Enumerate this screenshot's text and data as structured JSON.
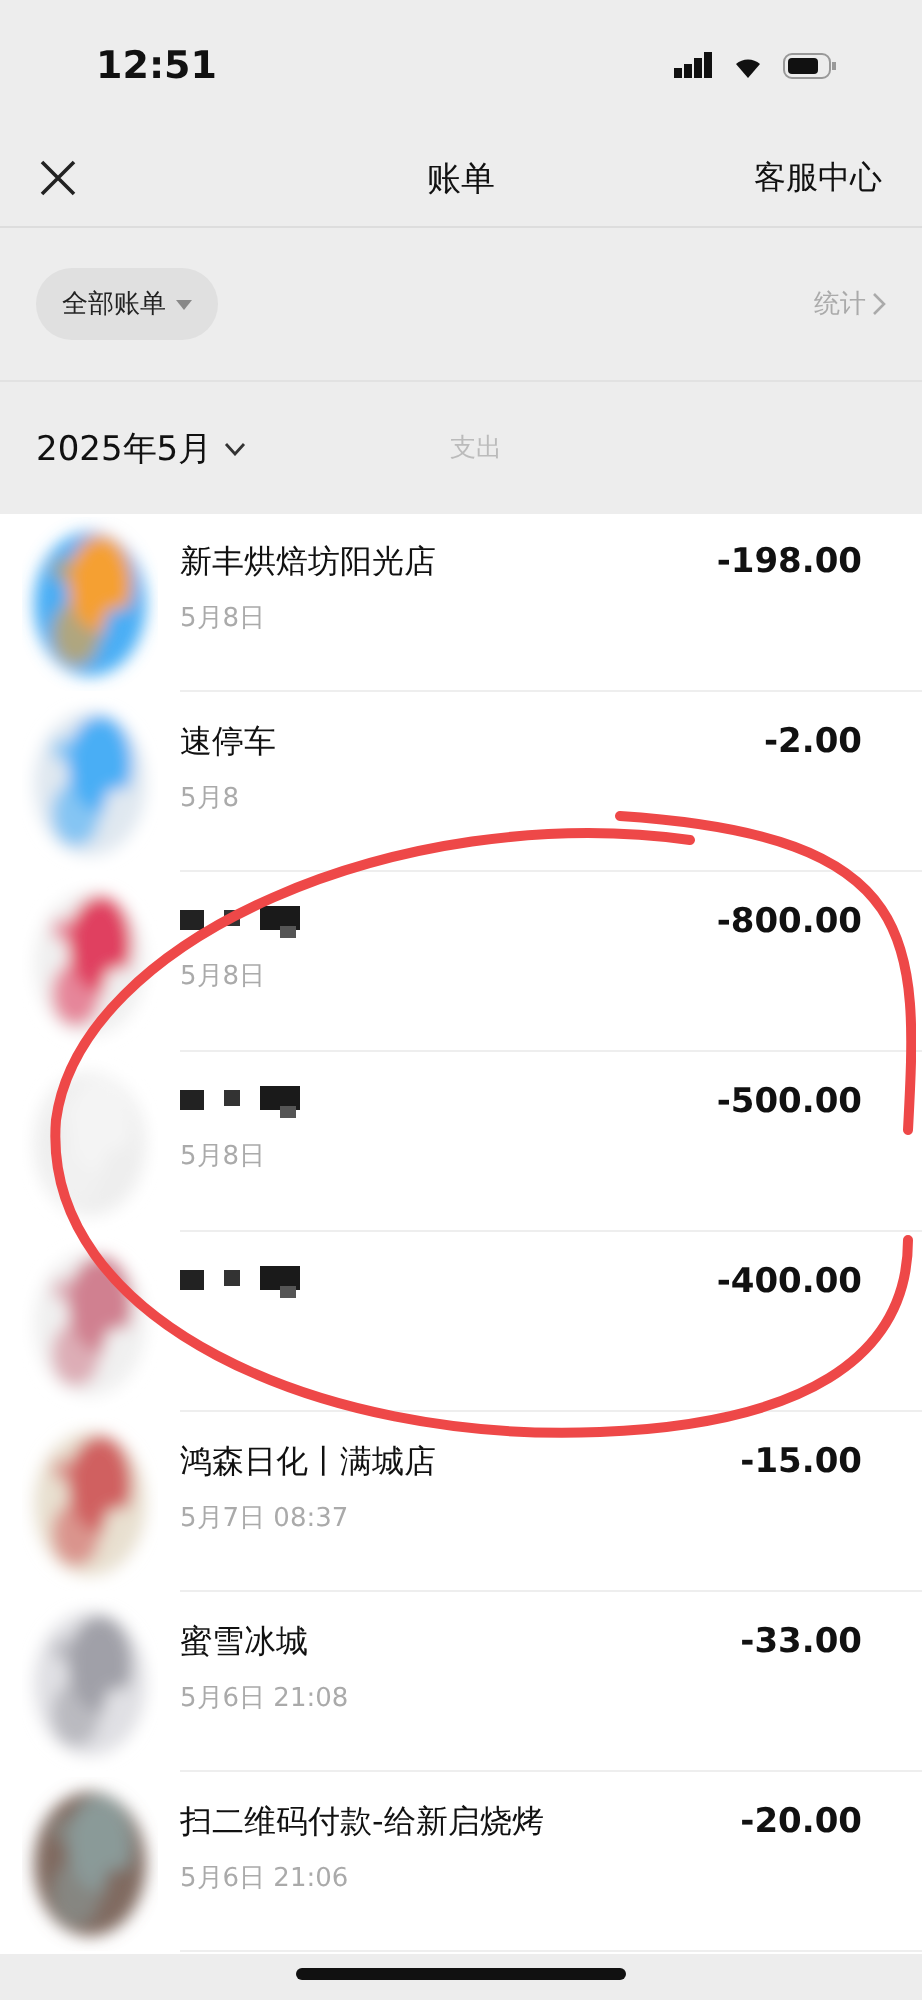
{
  "status_bar": {
    "time": "12:51"
  },
  "nav": {
    "title": "账单",
    "action": "客服中心"
  },
  "filter": {
    "label": "全部账单",
    "stats": "统计"
  },
  "month": {
    "label": "2025年5月",
    "summary": "支出"
  },
  "rows": [
    {
      "title": "新丰烘焙坊阳光店",
      "date": "5月8日",
      "amount": "-198.00",
      "redacted": false
    },
    {
      "title": "速停车",
      "date": "5月8",
      "amount": "-2.00",
      "redacted": false
    },
    {
      "date": "5月8日",
      "amount": "-800.00",
      "redacted": true
    },
    {
      "date": "5月8日",
      "amount": "-500.00",
      "redacted": true
    },
    {
      "amount": "-400.00",
      "redacted": true
    },
    {
      "title": "鸿森日化丨满城店",
      "date": "5月7日 08:37",
      "amount": "-15.00",
      "redacted": false
    },
    {
      "title": "蜜雪冰城",
      "date": "5月6日 21:08",
      "amount": "-33.00",
      "redacted": false
    },
    {
      "title": "扫二维码付款-给新启烧烤",
      "date": "5月6日 21:06",
      "amount": "-20.00",
      "redacted": false
    }
  ]
}
